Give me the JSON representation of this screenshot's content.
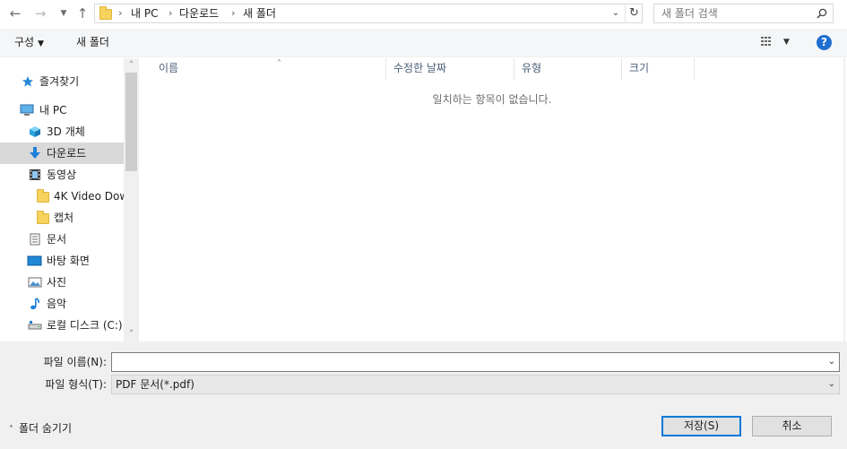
{
  "address_bar": {
    "breadcrumbs": [
      "내 PC",
      "다운로드",
      "새 폴더"
    ],
    "separator": "›",
    "search_placeholder": "새 폴더 검색"
  },
  "toolbar": {
    "organize_label": "구성",
    "new_folder_label": "새 폴더",
    "help_label": "?"
  },
  "nav_pane": {
    "items": [
      {
        "label": "즐겨찾기",
        "icon": "star-icon"
      },
      {
        "label": "내 PC",
        "icon": "computer-icon"
      },
      {
        "label": "3D 개체",
        "icon": "cube-icon"
      },
      {
        "label": "다운로드",
        "icon": "download-arrow-icon"
      },
      {
        "label": "동영상",
        "icon": "film-icon"
      },
      {
        "label": "4K Video Dow",
        "icon": "folder-icon"
      },
      {
        "label": "캡처",
        "icon": "folder-icon"
      },
      {
        "label": "문서",
        "icon": "document-icon"
      },
      {
        "label": "바탕 화면",
        "icon": "desktop-icon"
      },
      {
        "label": "사진",
        "icon": "picture-icon"
      },
      {
        "label": "음악",
        "icon": "music-note-icon"
      },
      {
        "label": "로컬 디스크 (C:)",
        "icon": "drive-icon"
      }
    ],
    "selected": "다운로드"
  },
  "file_list": {
    "columns": [
      "이름",
      "수정한 날짜",
      "유형",
      "크기"
    ],
    "empty_message": "일치하는 항목이 없습니다."
  },
  "form": {
    "filename_label": "파일 이름(N):",
    "filename_value": "",
    "filetype_label": "파일 형식(T):",
    "filetype_value": "PDF 문서(*.pdf)",
    "hide_folders_label": "폴더 숨기기",
    "save_label": "저장(S)",
    "cancel_label": "취소"
  },
  "colors": {
    "selection": "#cce8ff",
    "accent": "#0078d7",
    "folder": "#f7d35e",
    "help": "#1f6fd1"
  }
}
